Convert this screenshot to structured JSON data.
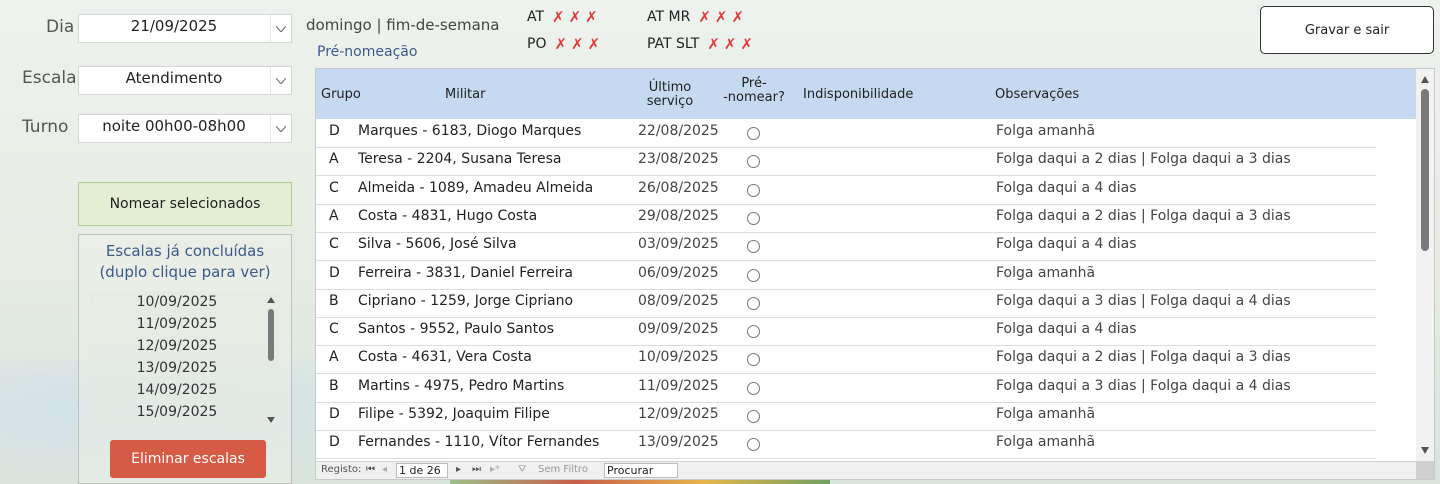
{
  "form": {
    "dia_label": "Dia",
    "dia_value": "21/09/2025",
    "escala_label": "Escala",
    "escala_value": "Atendimento",
    "turno_label": "Turno",
    "turno_value": "noite 00h00-08h00",
    "day_info": "domingo | fim-de-semana",
    "prenomeacao": "Pré-nomeação"
  },
  "status_tags": [
    {
      "label": "AT",
      "marks": "✗✗✗"
    },
    {
      "label": "PO",
      "marks": "✗✗✗"
    },
    {
      "label": "AT MR",
      "marks": "✗✗✗"
    },
    {
      "label": "PAT SLT",
      "marks": "✗✗✗"
    }
  ],
  "buttons": {
    "save_exit": "Gravar e sair",
    "nominate_selected": "Nomear selecionados",
    "delete_scales": "Eliminar escalas"
  },
  "completed_panel": {
    "title_line1": "Escalas já concluídas",
    "title_line2": "(duplo clique para ver)",
    "dates": [
      "10/09/2025",
      "11/09/2025",
      "12/09/2025",
      "13/09/2025",
      "14/09/2025",
      "15/09/2025"
    ]
  },
  "table": {
    "headers": {
      "grupo": "Grupo",
      "militar": "Militar",
      "ultimo_1": "Último",
      "ultimo_2": "serviço",
      "pre_1": "Pré-",
      "pre_2": "-nomear?",
      "indisp": "Indisponibilidade",
      "obs": "Observações"
    },
    "rows": [
      {
        "grupo": "D",
        "militar": "Marques - 6183, Diogo Marques",
        "ultimo": "22/08/2025",
        "obs": "Folga amanhã"
      },
      {
        "grupo": "A",
        "militar": "Teresa - 2204, Susana Teresa",
        "ultimo": "23/08/2025",
        "obs": "Folga daqui a 2 dias | Folga daqui a 3 dias"
      },
      {
        "grupo": "C",
        "militar": "Almeida - 1089, Amadeu Almeida",
        "ultimo": "26/08/2025",
        "obs": "Folga daqui a 4 dias"
      },
      {
        "grupo": "A",
        "militar": "Costa - 4831, Hugo Costa",
        "ultimo": "29/08/2025",
        "obs": "Folga daqui a 2 dias | Folga daqui a 3 dias"
      },
      {
        "grupo": "C",
        "militar": "Silva - 5606, José Silva",
        "ultimo": "03/09/2025",
        "obs": "Folga daqui a 4 dias"
      },
      {
        "grupo": "D",
        "militar": "Ferreira - 3831, Daniel Ferreira",
        "ultimo": "06/09/2025",
        "obs": "Folga amanhã"
      },
      {
        "grupo": "B",
        "militar": "Cipriano - 1259, Jorge Cipriano",
        "ultimo": "08/09/2025",
        "obs": "Folga daqui a 3 dias | Folga daqui a 4 dias"
      },
      {
        "grupo": "C",
        "militar": "Santos - 9552, Paulo Santos",
        "ultimo": "09/09/2025",
        "obs": "Folga daqui a 4 dias"
      },
      {
        "grupo": "A",
        "militar": "Costa - 4631, Vera Costa",
        "ultimo": "10/09/2025",
        "obs": "Folga daqui a 2 dias | Folga daqui a 3 dias"
      },
      {
        "grupo": "B",
        "militar": "Martins - 4975, Pedro Martins",
        "ultimo": "11/09/2025",
        "obs": "Folga daqui a 3 dias | Folga daqui a 4 dias"
      },
      {
        "grupo": "D",
        "militar": "Filipe - 5392, Joaquim Filipe",
        "ultimo": "12/09/2025",
        "obs": "Folga amanhã"
      },
      {
        "grupo": "D",
        "militar": "Fernandes - 1110, Vítor Fernandes",
        "ultimo": "13/09/2025",
        "obs": "Folga amanhã"
      }
    ]
  },
  "navigation": {
    "record_label": "Registo:",
    "record_value": "1 de 26",
    "filter_label": "Sem Filtro",
    "search_value": "Procurar"
  }
}
